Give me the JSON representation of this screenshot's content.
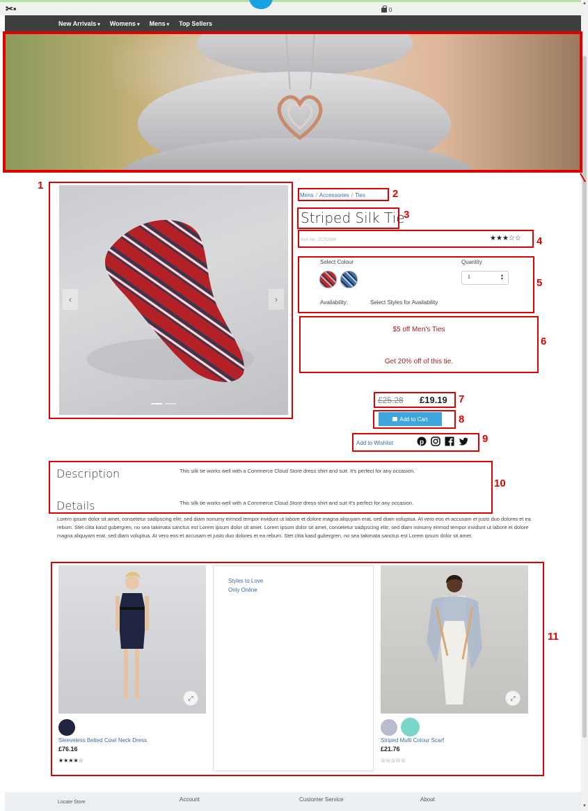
{
  "header": {
    "cart_count": "0",
    "nav": [
      {
        "label": "New Arrivals",
        "dropdown": true
      },
      {
        "label": "Womens",
        "dropdown": true
      },
      {
        "label": "Mens",
        "dropdown": true
      },
      {
        "label": "Top Sellers",
        "dropdown": false
      }
    ]
  },
  "annotations": [
    "1",
    "2",
    "3",
    "4",
    "5",
    "6",
    "7",
    "8",
    "9",
    "10",
    "11"
  ],
  "product": {
    "breadcrumb": [
      "Mens",
      "Accessories",
      "Ties"
    ],
    "title": "Striped Silk Tie",
    "item_no": "Item No. 25752986",
    "rating": {
      "filled": 3,
      "total": 5
    },
    "select_colour_label": "Select Colour",
    "quantity_label": "Quantity",
    "quantity_value": "1",
    "availability_label": "Availability:",
    "availability_value": "Select Styles for Availability",
    "promo_1": "$5 off Men's Ties",
    "promo_2": "Get 20% off of this tie.",
    "price_old": "£25.28",
    "price_new": "£19.19",
    "add_to_cart": "Add to Cart",
    "add_to_wishlist": "Add to Wishlist",
    "carousel": {
      "prev": "‹",
      "next": "›",
      "slides": 2,
      "active": 1
    }
  },
  "details": {
    "description_title": "Description",
    "description_text": "This silk tie works well with a Commerce Cloud Store dress shirt and suit. It's perfect for any occasion.",
    "details_title": "Details",
    "details_text": "This silk tie works well with a Commerce Cloud Store dress shirt and suit It's perfect for any occasion.",
    "lorem": "Lorem ipsum dolor sit amet, consetetur sadipscing elitr, sed diam nonumy eirmod tempor invidunt ut labore et dolore magna aliquyam erat, sed diam voluptua. At vero eos et accusam et justo duo dolores et ea rebum. Stet clita kasd gubergren, no sea takimata sanctus est Lorem ipsum dolor sit amet. Lorem ipsum dolor sit amet, consetetur sadipscing elitr, sed diam nonumy eirmod tempor invidunt ut labore et dolore magna aliquyam erat, sed diam voluptua. At vero eos et accusam et justo duo dolores et ea rebum. Stet clita kasd gubergren, no sea takimata sanctus est Lorem ipsum dolor sit amet."
  },
  "tiles": [
    {
      "name": "Sleeveless Belted Cowl Neck Dress",
      "price": "£76.16",
      "rating": {
        "filled": 4,
        "total": 5
      },
      "swatches": [
        "#1f2540"
      ]
    },
    {
      "links": [
        "Styles to Love",
        "Only Online"
      ]
    },
    {
      "name": "Striped Multi Colour Scarf",
      "price": "£21.76",
      "rating": {
        "filled": 0,
        "total": 5
      },
      "swatches": [
        "#b8bccd",
        "#79d6c8"
      ]
    }
  ],
  "footer": [
    "Locate Store",
    "Account",
    "Customer Service",
    "About"
  ],
  "colors": {
    "accent": "#3fa6dd",
    "annotation": "#e00000",
    "nav_bg": "#3e3e3e",
    "link": "#3a6ea5",
    "promo": "#a02020"
  },
  "icons": [
    "tools-icon",
    "cart-icon",
    "chevron-left-icon",
    "chevron-right-icon",
    "pinterest-icon",
    "instagram-icon",
    "facebook-icon",
    "twitter-icon",
    "expand-icon",
    "star-icon"
  ]
}
